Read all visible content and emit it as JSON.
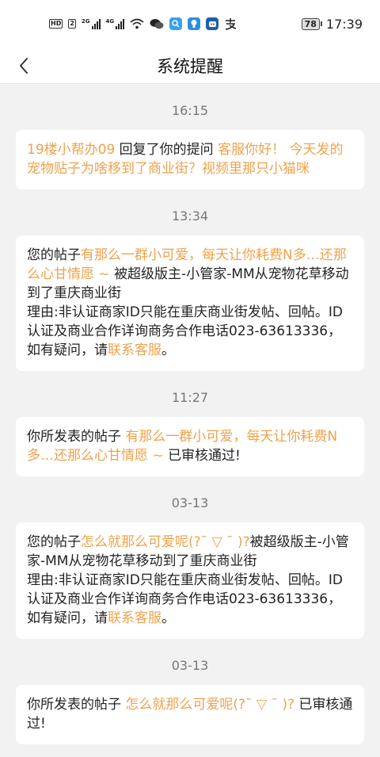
{
  "status_bar": {
    "chip": "HD",
    "sim_label": "2",
    "net1": "2G",
    "net2": "4G",
    "battery": "78",
    "time": "17:39"
  },
  "header": {
    "title": "系统提醒",
    "back_icon": "chevron-left-icon"
  },
  "notifications": [
    {
      "time": "16:15",
      "user": "19楼小帮办09",
      "middle": " 回复了你的提问 ",
      "quote": "客服你好！ 今天发的宠物贴子为啥移到了商业街？视频里那只小猫咪"
    },
    {
      "time": "13:34",
      "prefix": "您的帖子",
      "post_title": "有那么一群小可爱，每天让你耗费N多…还那么心甘情愿 ~ ",
      "body": "被超级版主-小管家-MM从宠物花草移动到了重庆商业街\n理由:非认证商家ID只能在重庆商业街发帖、回帖。ID认证及商业合作详询商务合作电话023-63613336，如有疑问，请",
      "link": "联系客服",
      "suffix": "。"
    },
    {
      "time": "11:27",
      "prefix": "你所发表的帖子 ",
      "post_title": "有那么一群小可爱，每天让你耗费N多…还那么心甘情愿 ~ ",
      "suffix": " 已审核通过!"
    },
    {
      "time": "03-13",
      "prefix": "您的帖子",
      "post_title": "怎么就那么可爱呢(?ˉ ▽ ˉ )?",
      "body": "被超级版主-小管家-MM从宠物花草移动到了重庆商业街\n理由:非认证商家ID只能在重庆商业街发帖、回帖。ID认证及商业合作详询商务合作电话023-63613336，如有疑问，请",
      "link": "联系客服",
      "suffix": "。"
    },
    {
      "time": "03-13",
      "prefix": "你所发表的帖子 ",
      "post_title": "怎么就那么可爱呢(?ˉ ▽ ˉ )?",
      "suffix": " 已审核通过!"
    }
  ],
  "colors": {
    "accent": "#f0a24c",
    "background": "#f2f2f2",
    "card": "#ffffff",
    "time": "#777777"
  }
}
